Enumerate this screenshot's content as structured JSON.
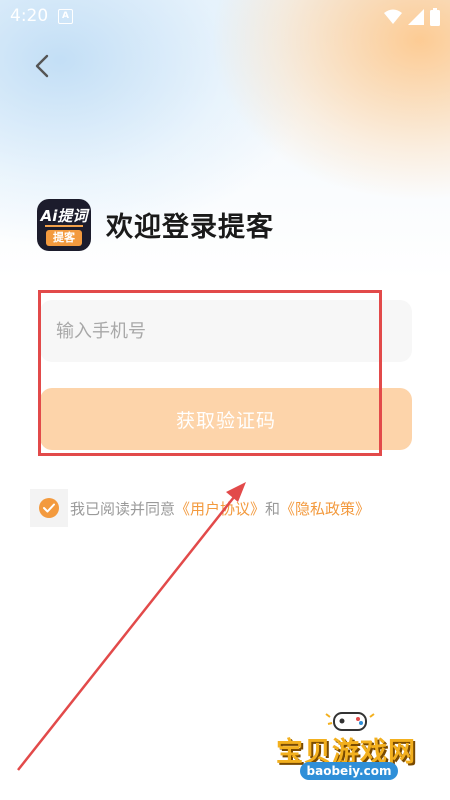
{
  "status_bar": {
    "time": "4:20",
    "indicator": "A"
  },
  "header": {
    "back_icon": "chevron-left-icon"
  },
  "brand": {
    "logo_top": "Ai提词",
    "logo_bottom": "提客",
    "welcome": "欢迎登录提客"
  },
  "form": {
    "phone_placeholder": "输入手机号",
    "phone_value": "",
    "get_code_label": "获取验证码"
  },
  "agreement": {
    "checked": true,
    "prefix": "我已阅读并同意",
    "user_agreement": "《用户协议》",
    "conjunction": "和",
    "privacy_policy": "《隐私政策》"
  },
  "watermark": {
    "title": "宝贝游戏网",
    "url": "baobeiy.com"
  },
  "colors": {
    "accent": "#f39a3e",
    "button_disabled": "#fdd4aa",
    "annotation": "#e24a4a"
  }
}
